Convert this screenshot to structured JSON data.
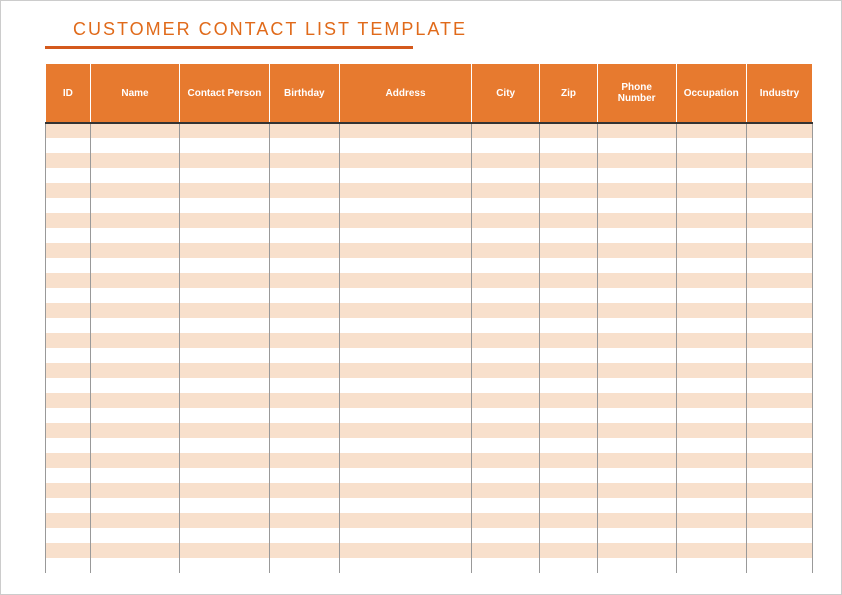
{
  "title": "CUSTOMER CONTACT LIST TEMPLATE",
  "columns": [
    "ID",
    "Name",
    "Contact Person",
    "Birthday",
    "Address",
    "City",
    "Zip",
    "Phone Number",
    "Occupation",
    "Industry"
  ],
  "row_count": 30,
  "colors": {
    "header_bg": "#e77a2f",
    "row_alt_bg": "#f8e0cc",
    "title_color": "#e06a1a",
    "underline_color": "#d4591c"
  }
}
